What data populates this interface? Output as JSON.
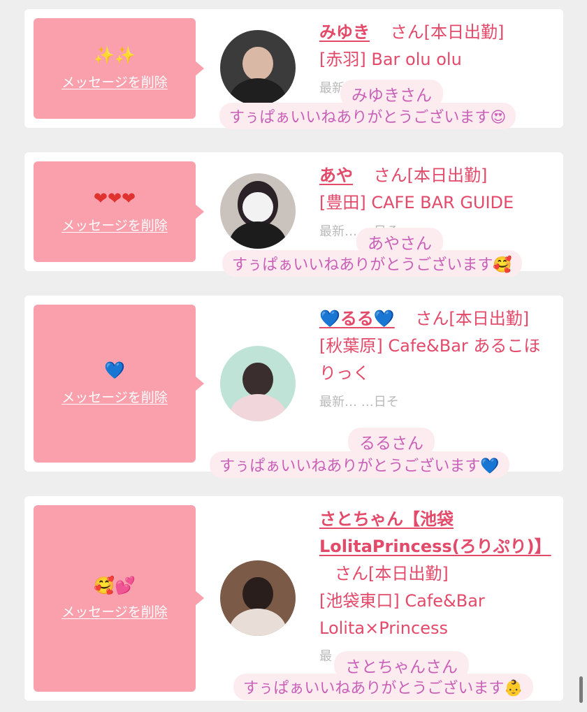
{
  "delete_label": "メッセージを削除",
  "honorific": "さん",
  "theme": {
    "card_pink": "#f9a0ac",
    "name_red": "#e34a6a",
    "message_purple": "#c860b8",
    "message_bg": "#fdecef"
  },
  "cards": [
    {
      "emoji": "✨✨",
      "name": "みゆき",
      "status": "[本日出勤]",
      "location": "[赤羽] Bar olu olu",
      "faded": "最新… …日そ",
      "sender": "みゆきさん",
      "message": "すぅぱぁいいねありがとうございます😍"
    },
    {
      "emoji": "❤❤❤",
      "name": "あや",
      "status": "[本日出勤]",
      "location": "[豊田] CAFE BAR GUIDE",
      "faded": "最新… …日そ",
      "sender": "あやさん",
      "message": "すぅぱぁいいねありがとうございます🥰"
    },
    {
      "emoji": "💙",
      "name_heart_left": "💙",
      "name": "るる",
      "name_heart_right": "💙",
      "status": "[本日出勤]",
      "location": "[秋葉原] Cafe&Bar あるこほりっく",
      "faded": "最新… …日そ",
      "sender": "るるさん",
      "message": "すぅぱぁいいねありがとうございます💙"
    },
    {
      "emoji": "🥰💕",
      "name": "さとちゃん【池袋LolitaPrincess(ろりぷり)】",
      "status": "[本日出勤]",
      "location": "[池袋東口] Cafe&Bar Lolita×Princess",
      "faded": "最",
      "sender": "さとちゃんさん",
      "message": "すぅぱぁいいねありがとうございます👶"
    }
  ]
}
